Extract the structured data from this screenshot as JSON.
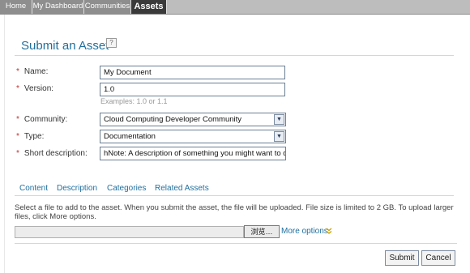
{
  "nav": {
    "tabs": [
      {
        "label": "Home"
      },
      {
        "label": "My Dashboard"
      },
      {
        "label": "Communities"
      },
      {
        "label": "Assets"
      }
    ]
  },
  "page": {
    "title": "Submit an Asset",
    "help_icon": "?"
  },
  "form": {
    "name": {
      "label": "Name:",
      "value": "My Document"
    },
    "version": {
      "label": "Version:",
      "value": "1.0",
      "hint": "Examples: 1.0 or 1.1"
    },
    "community": {
      "label": "Community:",
      "value": "Cloud Computing Developer Community"
    },
    "type": {
      "label": "Type:",
      "value": "Documentation"
    },
    "short_description": {
      "label": "Short description:",
      "value": "hNote: A description of something you might want to do"
    },
    "required_marker": "*"
  },
  "subtabs": {
    "items": [
      {
        "label": "Content"
      },
      {
        "label": "Description"
      },
      {
        "label": "Categories"
      },
      {
        "label": "Related Assets"
      }
    ]
  },
  "upload": {
    "instructions": "Select a file to add to the asset. When you submit the asset, the file will be uploaded. File size is limited to 2 GB. To upload larger files, click More options.",
    "browse_label": "浏览…",
    "more_options_label": "More options",
    "more_options_icon": "double-chevron-down-icon"
  },
  "actions": {
    "submit_label": "Submit",
    "cancel_label": "Cancel"
  }
}
